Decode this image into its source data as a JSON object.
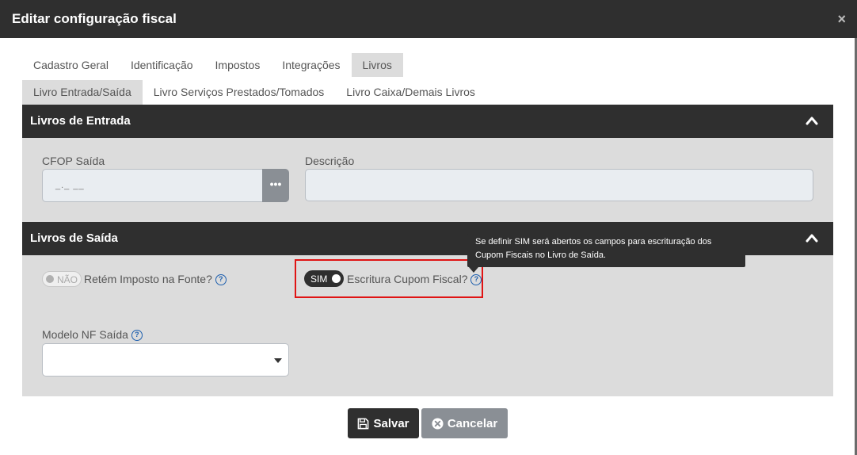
{
  "modal": {
    "title": "Editar configuração fiscal",
    "close": "×"
  },
  "tabs": [
    "Cadastro Geral",
    "Identificação",
    "Impostos",
    "Integrações",
    "Livros"
  ],
  "subtabs": [
    "Livro Entrada/Saída",
    "Livro Serviços Prestados/Tomados",
    "Livro Caixa/Demais Livros"
  ],
  "entrada": {
    "title": "Livros de Entrada",
    "cfop_label": "CFOP Saída",
    "cfop_mask": "_._ __",
    "dots": "•••",
    "descricao_label": "Descrição",
    "descricao_value": ""
  },
  "saida": {
    "title": "Livros de Saída",
    "retem_toggle": "NÃO",
    "retem_label": "Retém Imposto na Fonte?",
    "cupom_toggle": "SIM",
    "cupom_label": "Escritura Cupom Fiscal?",
    "tooltip_line1": "Se definir SIM será abertos os campos para escrituração dos",
    "tooltip_line2": "Cupom Fiscais no Livro de Saída.",
    "modelo_label": "Modelo NF Saída",
    "modelo_value": ""
  },
  "help_glyph": "?",
  "buttons": {
    "save": "Salvar",
    "cancel": "Cancelar"
  },
  "colors": {
    "dark": "#2f2f2f",
    "panel": "#dcdcdc",
    "highlight": "#e01414",
    "help": "#1d5fae"
  }
}
